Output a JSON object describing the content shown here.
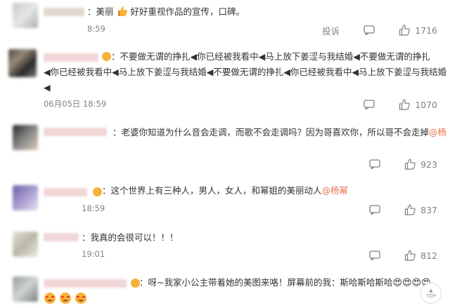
{
  "colors": {
    "mention": "#eb7350",
    "muted": "#808080",
    "accent_orange": "#f39c2a"
  },
  "comments": [
    {
      "text": "美丽 ",
      "text2": " 好好重视作品的宣传，口碑。",
      "time": "8:59",
      "report": "投诉",
      "likes": "1716"
    },
    {
      "line1": "不要做无谓的挣扎◀你已经被我看中◀马上放下姜涩与我结婚◀不要做无谓的挣扎",
      "line2": "◀你已经被我看中◀马上放下姜涩与我结婚◀不要做无谓的挣扎◀你已经被我看中◀马上放下姜涩与我结婚",
      "line3": "◀",
      "time": "06月05日  18:59",
      "likes": "1070"
    },
    {
      "text": "老婆你知道为什么音会走调，而歌不会走调吗？因为哥喜欢你，所以哥不会走掉",
      "mention": "@杨",
      "likes": "923"
    },
    {
      "text": "这个世界上有三种人，男人，女人，和幂姐的美丽动人",
      "mention": "@杨幂",
      "time": "18:59",
      "likes": "837"
    },
    {
      "text": "我真的会很可以！！！",
      "time": "19:01",
      "likes": "812"
    },
    {
      "text": "呀~我家小公主带着她的美图来咯！屏幕前的我：斯哈斯哈斯哈",
      "emojis": "😍😍😍😍"
    }
  ],
  "top_button": {
    "arrow": "▲",
    "label": "TOP"
  }
}
